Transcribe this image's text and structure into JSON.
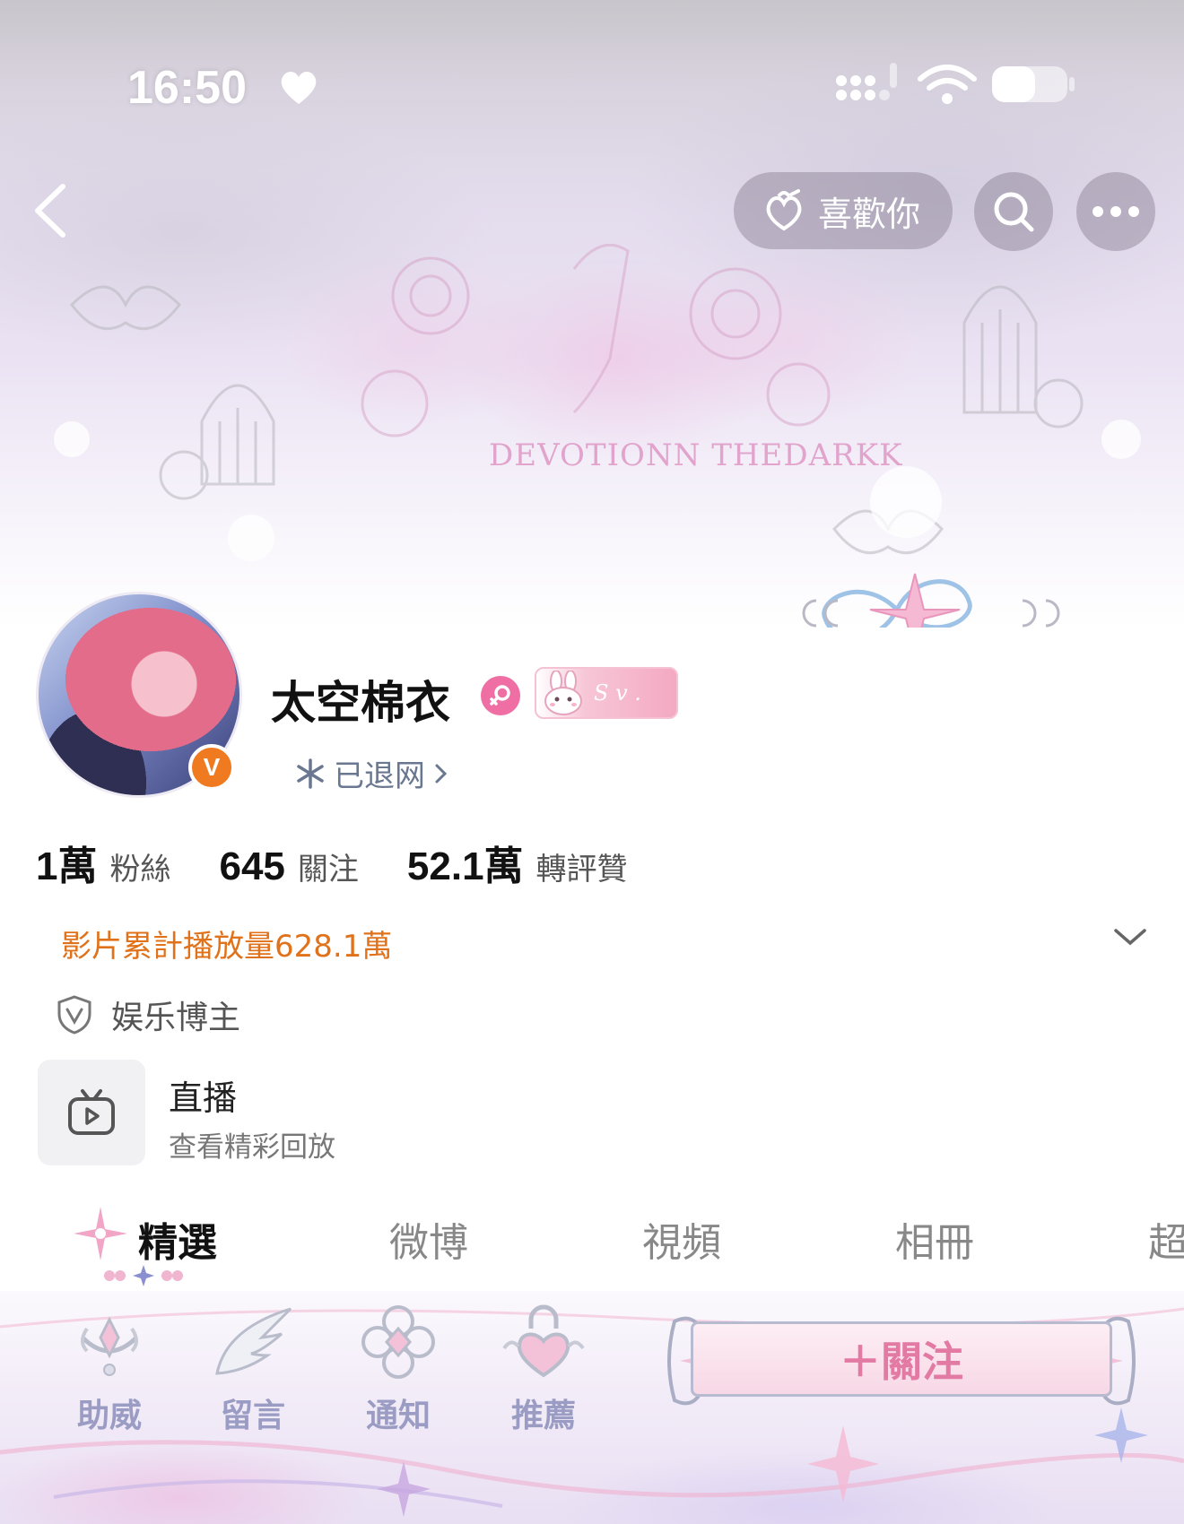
{
  "status_bar": {
    "time": "16:50"
  },
  "banner": {
    "text": "DEVOTIONN THEDARKK"
  },
  "top_nav": {
    "like_label": "喜歡你"
  },
  "profile": {
    "name": "太空棉衣",
    "verified_badge": "V",
    "vip_badge_text": "S v .",
    "status_text": "已退网"
  },
  "stats": [
    {
      "value": "1萬",
      "label": "粉絲"
    },
    {
      "value": "645",
      "label": "關注"
    },
    {
      "value": "52.1萬",
      "label": "轉評贊"
    }
  ],
  "views_summary": "影片累計播放量628.1萬",
  "certification": "娱乐博主",
  "live": {
    "title": "直播",
    "subtitle": "查看精彩回放"
  },
  "tabs": [
    {
      "label": "精選",
      "active": true
    },
    {
      "label": "微博",
      "active": false
    },
    {
      "label": "視頻",
      "active": false
    },
    {
      "label": "相冊",
      "active": false
    },
    {
      "label": "超",
      "active": false
    }
  ],
  "bottom_bar": {
    "items": [
      {
        "label": "助威",
        "icon": "crown-gem-icon"
      },
      {
        "label": "留言",
        "icon": "wing-icon"
      },
      {
        "label": "通知",
        "icon": "diamond-flower-icon"
      },
      {
        "label": "推薦",
        "icon": "heart-lock-icon"
      }
    ],
    "follow_label": "＋關注"
  },
  "colors": {
    "accent_orange": "#e0721b",
    "follow_pink": "#e27aa3",
    "bottom_label": "#9a9cc4",
    "gender_pink": "#ef6fa4"
  }
}
